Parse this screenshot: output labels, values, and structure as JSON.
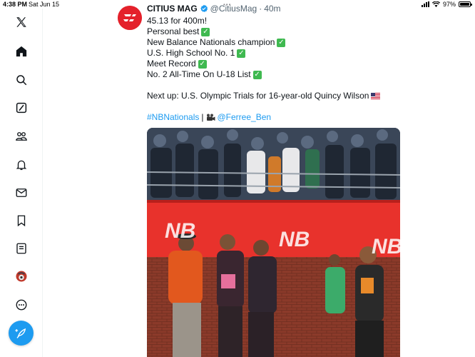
{
  "status_bar": {
    "time": "4:38 PM",
    "date": "Sat Jun 15",
    "battery": "97%",
    "battery_level": 0.97,
    "icons": [
      "cellular-signal-icon",
      "wifi-icon",
      "battery-icon"
    ]
  },
  "sidebar": {
    "items": [
      {
        "name": "x-logo-icon"
      },
      {
        "name": "home-icon"
      },
      {
        "name": "search-icon"
      },
      {
        "name": "grok-icon"
      },
      {
        "name": "communities-icon"
      },
      {
        "name": "notifications-icon"
      },
      {
        "name": "messages-icon"
      },
      {
        "name": "bookmarks-icon"
      },
      {
        "name": "lists-icon"
      },
      {
        "name": "profile-avatar"
      },
      {
        "name": "more-icon"
      }
    ],
    "compose_icon": "compose-post-icon",
    "accent": "#1d9bf0"
  },
  "tweet": {
    "author_name": "CITIUS MAG",
    "handle": "@CitiusMag",
    "separator": "·",
    "time": "40m",
    "verified": true,
    "lines": [
      "45.13 for 400m!",
      "Personal best",
      "New Balance Nationals champion",
      "U.S. High School No. 1",
      "Meet Record",
      "No. 2 All-Time On U-18 List"
    ],
    "next_up": "Next up: U.S. Olympic Trials for 16-year-old Quincy Wilson",
    "hashtag": "#NBNationals",
    "pipe": "|",
    "mention": "@Ferree_Ben",
    "brand_color": "#e4212b"
  },
  "media": {
    "banner_text": "NB",
    "colors": {
      "banner": "#e8322c",
      "brick": "#8b3a2a"
    }
  }
}
